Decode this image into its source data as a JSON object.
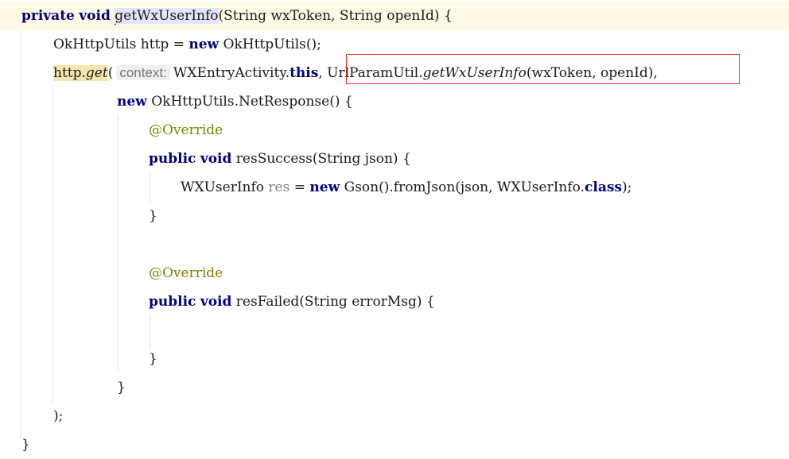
{
  "editor": {
    "lines": [
      {
        "parts": [
          {
            "t": "private",
            "c": "kw"
          },
          {
            "t": " "
          },
          {
            "t": "void",
            "c": "kw"
          },
          {
            "t": " "
          },
          {
            "t": "getWxUserInfo",
            "c": "hl-ident",
            "caret": true
          },
          {
            "t": "(String wxToken, String openId) {"
          }
        ]
      },
      {
        "parts": [
          {
            "t": "OkHttpUtils http = "
          },
          {
            "t": "new",
            "c": "kw"
          },
          {
            "t": " OkHttpUtils();"
          }
        ]
      },
      {
        "parts": [
          {
            "t": "http.",
            "c": "hl-get"
          },
          {
            "t": "get",
            "c": "hl-get ital"
          },
          {
            "t": "("
          },
          {
            "t": "context:",
            "c": "hint"
          },
          {
            "t": "WXEntryActivity."
          },
          {
            "t": "this",
            "c": "kw"
          },
          {
            "t": ", UrlParamUtil."
          },
          {
            "t": "getWxUserInfo",
            "c": "ital"
          },
          {
            "t": "(wxToken, openId),"
          }
        ]
      },
      {
        "parts": [
          {
            "t": "new",
            "c": "kw"
          },
          {
            "t": " OkHttpUtils.NetResponse() {"
          }
        ]
      },
      {
        "parts": [
          {
            "t": "@Override",
            "c": "ann"
          }
        ]
      },
      {
        "parts": [
          {
            "t": "public",
            "c": "kw"
          },
          {
            "t": " "
          },
          {
            "t": "void",
            "c": "kw"
          },
          {
            "t": " resSuccess(String json) {"
          }
        ]
      },
      {
        "parts": [
          {
            "t": "WXUserInfo "
          },
          {
            "t": "res",
            "c": "unused"
          },
          {
            "t": " = "
          },
          {
            "t": "new",
            "c": "kw"
          },
          {
            "t": " Gson().fromJson(json, WXUserInfo."
          },
          {
            "t": "class",
            "c": "kw"
          },
          {
            "t": ");"
          }
        ]
      },
      {
        "parts": [
          {
            "t": "}"
          }
        ]
      },
      {
        "parts": []
      },
      {
        "parts": [
          {
            "t": "@Override",
            "c": "ann"
          }
        ]
      },
      {
        "parts": [
          {
            "t": "public",
            "c": "kw"
          },
          {
            "t": " "
          },
          {
            "t": "void",
            "c": "kw"
          },
          {
            "t": " resFailed(String errorMsg) {"
          }
        ]
      },
      {
        "parts": []
      },
      {
        "parts": [
          {
            "t": "}"
          }
        ]
      },
      {
        "parts": [
          {
            "t": "}"
          }
        ]
      },
      {
        "parts": [
          {
            "t": ");"
          }
        ]
      },
      {
        "parts": [
          {
            "t": "}"
          }
        ]
      }
    ]
  }
}
